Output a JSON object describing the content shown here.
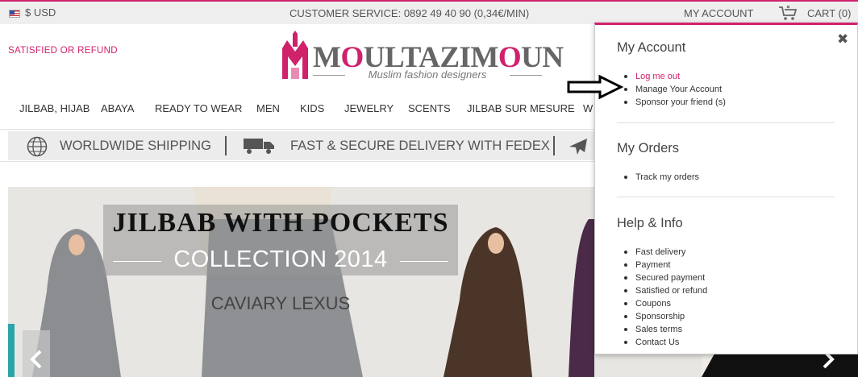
{
  "topbar": {
    "currency": "$ USD",
    "customer_service": "CUSTOMER SERVICE: 0892 49 40 90 (0,34€/MIN)",
    "my_account": "MY ACCOUNT",
    "cart": "CART (0)"
  },
  "header": {
    "satisfied": "SATISFIED OR REFUND",
    "logo": {
      "brand_parts": [
        "M",
        "O",
        "ULTAZIM",
        "O",
        "UN"
      ],
      "tagline": "Muslim fashion designers"
    }
  },
  "nav": {
    "items": [
      "JILBAB, HIJAB",
      "ABAYA",
      "READY TO WEAR",
      "MEN",
      "KIDS",
      "JEWELRY",
      "SCENTS",
      "JILBAB SUR MESURE",
      "W"
    ]
  },
  "shipping": {
    "worldwide": "WORLDWIDE SHIPPING",
    "fedex": "FAST & SECURE DELIVERY WITH FEDEX"
  },
  "hero": {
    "title": "JILBAB WITH POCKETS",
    "subtitle": "COLLECTION 2014",
    "fabric": "CAVIARY LEXUS"
  },
  "panel": {
    "my_account": {
      "title": "My Account",
      "items": [
        "Log me out",
        "Manage Your Account",
        "Sponsor your friend (s)"
      ]
    },
    "my_orders": {
      "title": "My Orders",
      "items": [
        "Track my orders"
      ]
    },
    "help": {
      "title": "Help & Info",
      "items": [
        "Fast delivery",
        "Payment",
        "Secured payment",
        "Satisfied or refund",
        "Coupons",
        "Sponsorship",
        "Sales terms",
        "Contact Us"
      ]
    }
  },
  "colors": {
    "accent": "#d0216b",
    "topbar_bg": "#efefef",
    "banner_bg": "#ececec"
  }
}
